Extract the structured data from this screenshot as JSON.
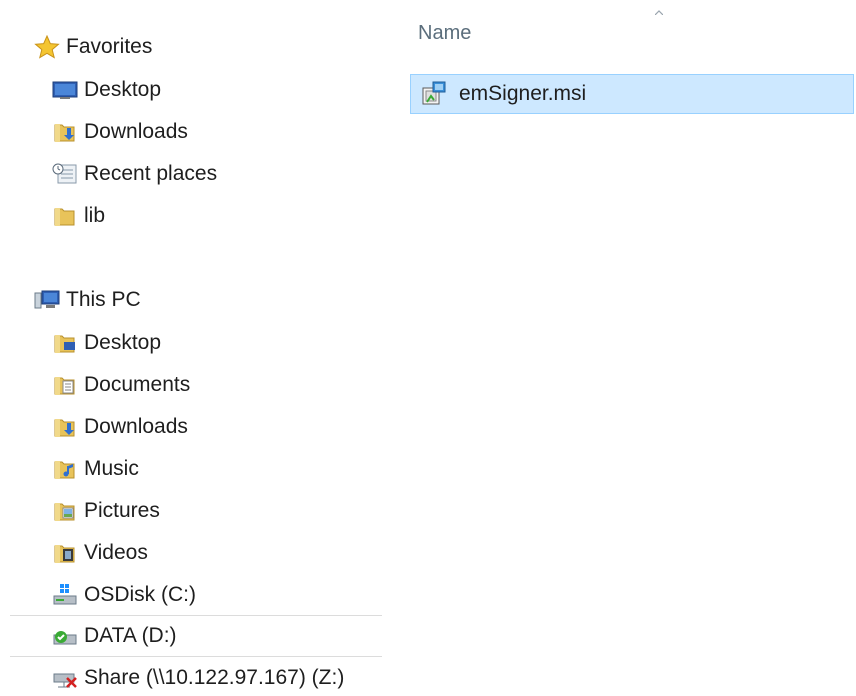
{
  "favorites": {
    "label": "Favorites",
    "items": [
      {
        "label": "Desktop",
        "icon": "desktop-icon"
      },
      {
        "label": "Downloads",
        "icon": "downloads-folder-icon"
      },
      {
        "label": "Recent places",
        "icon": "recent-places-icon"
      },
      {
        "label": "lib",
        "icon": "folder-icon"
      }
    ]
  },
  "this_pc": {
    "label": "This PC",
    "items": [
      {
        "label": "Desktop",
        "icon": "desktop-folder-icon"
      },
      {
        "label": "Documents",
        "icon": "documents-folder-icon"
      },
      {
        "label": "Downloads",
        "icon": "downloads-folder-icon"
      },
      {
        "label": "Music",
        "icon": "music-folder-icon"
      },
      {
        "label": "Pictures",
        "icon": "pictures-folder-icon"
      },
      {
        "label": "Videos",
        "icon": "videos-folder-icon"
      },
      {
        "label": "OSDisk (C:)",
        "icon": "system-drive-icon"
      },
      {
        "label": "DATA (D:)",
        "icon": "drive-icon"
      },
      {
        "label": "Share (\\\\10.122.97.167) (Z:)",
        "icon": "disconnected-network-drive-icon"
      }
    ]
  },
  "file_list": {
    "column_name": "Name",
    "files": [
      {
        "name": "emSigner.msi",
        "icon": "msi-installer-icon",
        "selected": true
      }
    ]
  },
  "colors": {
    "selection_bg": "#cde8ff",
    "selection_border": "#99d1ff",
    "folder": "#e8c35a",
    "header_text": "#5b6e7c"
  }
}
